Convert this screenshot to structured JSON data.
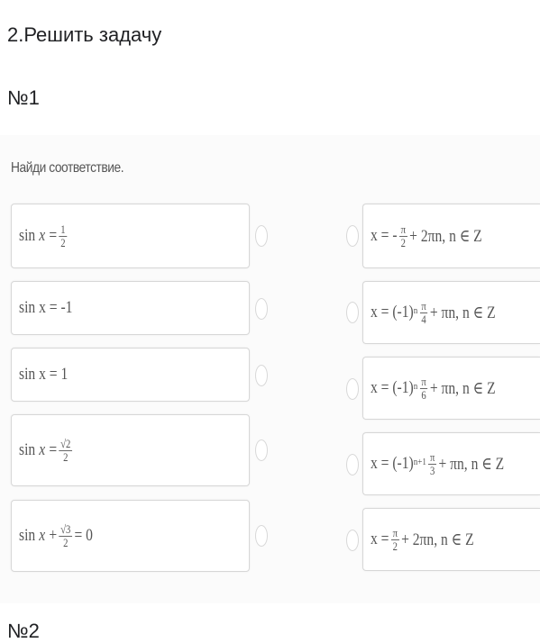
{
  "header": {
    "title": "2.Решить задачу",
    "number": "№1",
    "next_number": "№2"
  },
  "instruction": "Найди соответствие.",
  "left_items": [
    {
      "prefix": "sin",
      "var": "x",
      "eq": "=",
      "frac_num": "1",
      "frac_den": "2"
    },
    {
      "text": "sin x = -1"
    },
    {
      "text": "sin x = 1"
    },
    {
      "prefix": "sin",
      "var": "x",
      "eq": "=",
      "frac_num": "√2",
      "frac_den": "2"
    },
    {
      "prefix": "sin",
      "var": "x",
      "plus": "+",
      "frac_num": "√3",
      "frac_den": "2",
      "tail": "= 0"
    }
  ],
  "right_items": [
    {
      "a": "x = -",
      "frac_num": "π",
      "frac_den": "2",
      "b": "+ 2πn, n ∈ Z"
    },
    {
      "a": "x = (-1)",
      "sup": "n",
      "frac_num": "π",
      "frac_den": "4",
      "b": "+ πn, n ∈ Z"
    },
    {
      "a": "x = (-1)",
      "sup": "n",
      "frac_num": "π",
      "frac_den": "6",
      "b": "+ πn, n ∈ Z"
    },
    {
      "a": "x = (-1)",
      "sup": "n+1",
      "frac_num": "π",
      "frac_den": "3",
      "b": "+ πn, n ∈ Z"
    },
    {
      "a": "x = ",
      "frac_num": "π",
      "frac_den": "2",
      "b": "+ 2πn, n ∈ Z"
    }
  ]
}
